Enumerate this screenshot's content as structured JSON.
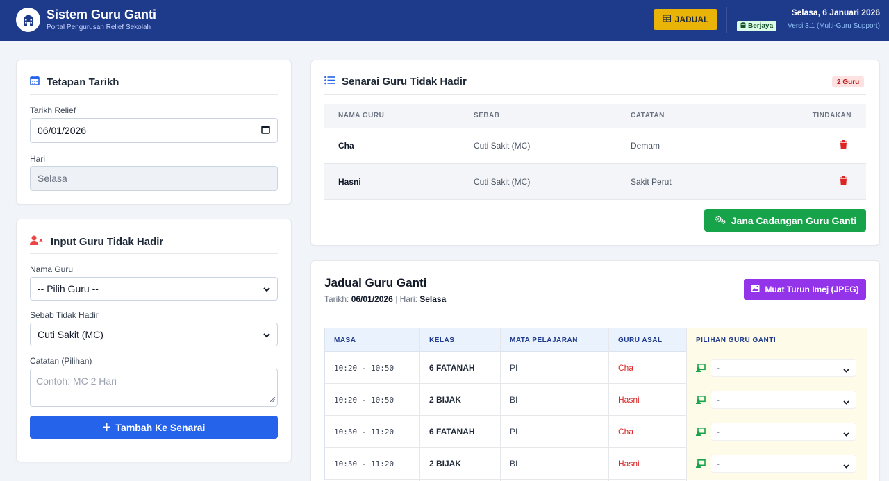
{
  "header": {
    "title": "Sistem Guru Ganti",
    "subtitle": "Portal Pengurusan Relief Sekolah",
    "jadual_button": "JADUAL",
    "date_text": "Selasa, 6 Januari 2026",
    "status_badge": "Berjaya",
    "version": "Versi 3.1 (Multi-Guru Support)"
  },
  "date_card": {
    "title": "Tetapan Tarikh",
    "date_label": "Tarikh Relief",
    "date_value": "06/01/2026",
    "day_label": "Hari",
    "day_value": "Selasa"
  },
  "input_card": {
    "title": "Input Guru Tidak Hadir",
    "name_label": "Nama Guru",
    "name_value": "-- Pilih Guru --",
    "reason_label": "Sebab Tidak Hadir",
    "reason_value": "Cuti Sakit (MC)",
    "note_label": "Catatan (Pilihan)",
    "note_placeholder": "Contoh: MC 2 Hari",
    "add_button": "Tambah Ke Senarai"
  },
  "absent_card": {
    "title": "Senarai Guru Tidak Hadir",
    "count_badge": "2 Guru",
    "columns": [
      "NAMA GURU",
      "SEBAB",
      "CATATAN",
      "TINDAKAN"
    ],
    "rows": [
      {
        "name": "Cha",
        "reason": "Cuti Sakit (MC)",
        "note": "Demam"
      },
      {
        "name": "Hasni",
        "reason": "Cuti Sakit (MC)",
        "note": "Sakit Perut"
      }
    ],
    "generate_button": "Jana Cadangan Guru Ganti"
  },
  "schedule_card": {
    "title": "Jadual Guru Ganti",
    "date_label": "Tarikh:",
    "date_value": "06/01/2026",
    "day_label": "Hari:",
    "day_value": "Selasa",
    "download_button": "Muat Turun Imej (JPEG)",
    "columns": [
      "MASA",
      "KELAS",
      "MATA PELAJARAN",
      "GURU ASAL",
      "PILIHAN GURU GANTI"
    ],
    "rows": [
      {
        "time": "10:20 - 10:50",
        "class": "6 FATANAH",
        "subject": "PI",
        "teacher": "Cha",
        "choice": "-"
      },
      {
        "time": "10:20 - 10:50",
        "class": "2 BIJAK",
        "subject": "BI",
        "teacher": "Hasni",
        "choice": "-"
      },
      {
        "time": "10:50 - 11:20",
        "class": "6 FATANAH",
        "subject": "PI",
        "teacher": "Cha",
        "choice": "-"
      },
      {
        "time": "10:50 - 11:20",
        "class": "2 BIJAK",
        "subject": "BI",
        "teacher": "Hasni",
        "choice": "-"
      }
    ]
  },
  "colors": {
    "header_bg": "#1e3a8a",
    "accent_yellow": "#eab308",
    "primary_blue": "#2563eb",
    "success_green": "#16a34a",
    "purple": "#9333ea",
    "danger_red": "#dc2626"
  }
}
